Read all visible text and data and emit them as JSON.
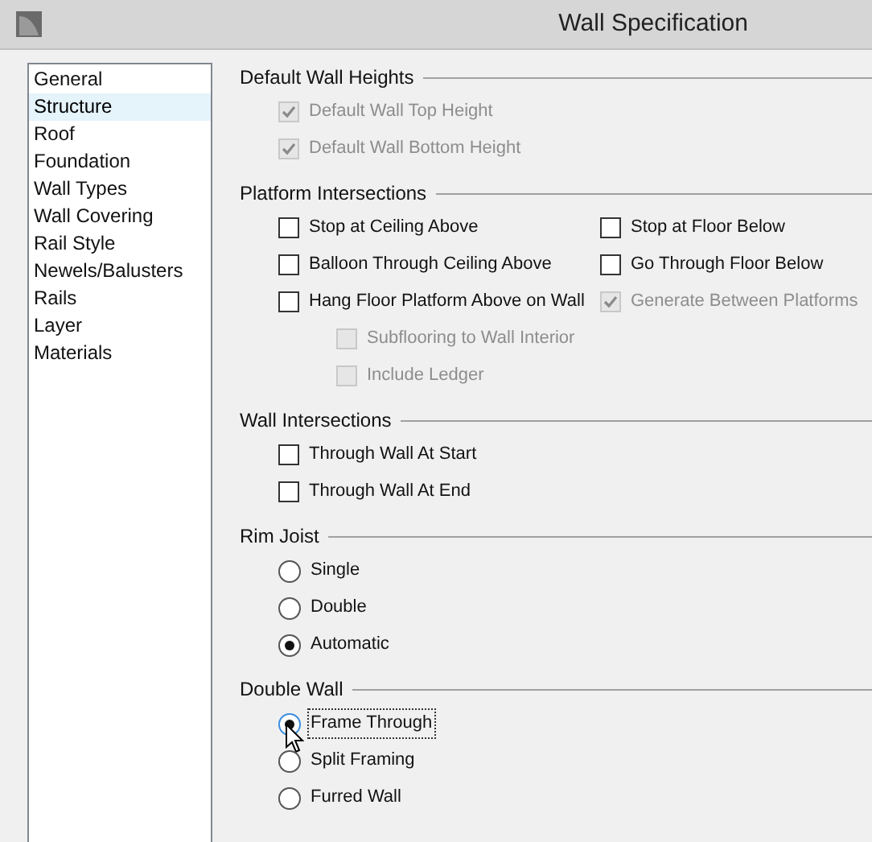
{
  "window": {
    "title": "Wall Specification"
  },
  "sidebar": {
    "items": [
      {
        "label": "General",
        "selected": false
      },
      {
        "label": "Structure",
        "selected": true
      },
      {
        "label": "Roof",
        "selected": false
      },
      {
        "label": "Foundation",
        "selected": false
      },
      {
        "label": "Wall Types",
        "selected": false
      },
      {
        "label": "Wall Covering",
        "selected": false
      },
      {
        "label": "Rail Style",
        "selected": false
      },
      {
        "label": "Newels/Balusters",
        "selected": false
      },
      {
        "label": "Rails",
        "selected": false
      },
      {
        "label": "Layer",
        "selected": false
      },
      {
        "label": "Materials",
        "selected": false
      }
    ]
  },
  "sections": [
    {
      "title": "Default Wall Heights",
      "kind": "checkboxes",
      "columns": [
        [
          {
            "label": "Default Wall Top Height",
            "checked": true,
            "disabled": true
          },
          {
            "label": "Default Wall Bottom Height",
            "checked": true,
            "disabled": true
          }
        ]
      ]
    },
    {
      "title": "Platform Intersections",
      "kind": "checkboxes",
      "columns": [
        [
          {
            "label": "Stop at Ceiling Above",
            "checked": false,
            "disabled": false
          },
          {
            "label": "Balloon Through Ceiling Above",
            "checked": false,
            "disabled": false
          },
          {
            "label": "Hang Floor Platform Above on Wall",
            "checked": false,
            "disabled": false,
            "children": [
              {
                "label": "Subflooring to Wall Interior",
                "checked": false,
                "disabled": true
              },
              {
                "label": "Include Ledger",
                "checked": false,
                "disabled": true
              }
            ]
          }
        ],
        [
          {
            "label": "Stop at Floor Below",
            "checked": false,
            "disabled": false
          },
          {
            "label": "Go Through Floor Below",
            "checked": false,
            "disabled": false
          },
          {
            "label": "Generate Between Platforms",
            "checked": true,
            "disabled": true
          }
        ]
      ]
    },
    {
      "title": "Wall Intersections",
      "kind": "checkboxes",
      "columns": [
        [
          {
            "label": "Through Wall At Start",
            "checked": false,
            "disabled": false
          },
          {
            "label": "Through Wall At End",
            "checked": false,
            "disabled": false
          }
        ]
      ]
    },
    {
      "title": "Rim Joist",
      "kind": "radios",
      "columns": [
        [
          {
            "label": "Single",
            "selected": false,
            "focused": false
          },
          {
            "label": "Double",
            "selected": false,
            "focused": false
          },
          {
            "label": "Automatic",
            "selected": true,
            "focused": false
          }
        ]
      ]
    },
    {
      "title": "Double Wall",
      "kind": "radios",
      "columns": [
        [
          {
            "label": "Frame Through",
            "selected": true,
            "focused": true
          },
          {
            "label": "Split Framing",
            "selected": false,
            "focused": false
          },
          {
            "label": "Furred Wall",
            "selected": false,
            "focused": false
          }
        ]
      ]
    }
  ]
}
